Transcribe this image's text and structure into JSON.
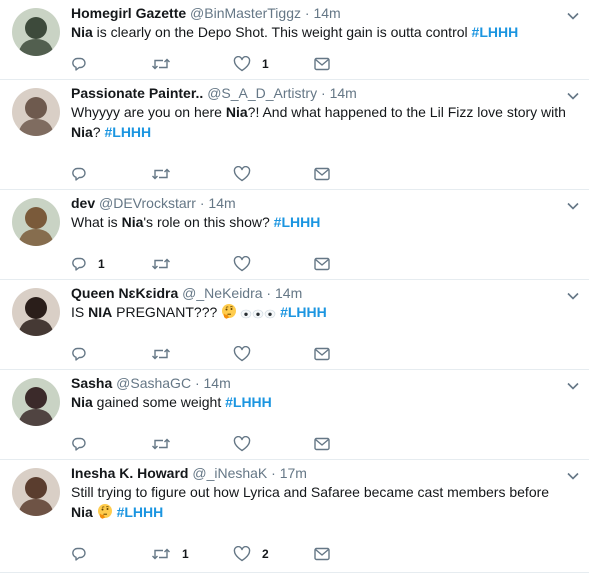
{
  "tweets": [
    {
      "name": "Homegirl Gazette",
      "handle": "@BinMasterTiggz",
      "time": "14m",
      "segments": [
        {
          "t": "Nia",
          "s": "bold"
        },
        {
          "t": " is clearly on the Depo Shot. This weight gain is outta control ",
          "s": "plain"
        },
        {
          "t": "#LHHH",
          "s": "tag"
        }
      ],
      "reply_count": "",
      "retweet_count": "",
      "like_count": "1",
      "avatar_color": "#3d4a3b"
    },
    {
      "name": "Passionate Painter..",
      "handle": "@S_A_D_Artistry",
      "time": "14m",
      "segments": [
        {
          "t": "Whyyyy are you on here ",
          "s": "plain"
        },
        {
          "t": "Nia",
          "s": "bold"
        },
        {
          "t": "?! And what happened to the Lil Fizz love story with ",
          "s": "plain"
        },
        {
          "t": "Nia",
          "s": "bold"
        },
        {
          "t": "? ",
          "s": "plain"
        },
        {
          "t": "#LHHH",
          "s": "tag"
        }
      ],
      "reply_count": "",
      "retweet_count": "",
      "like_count": "",
      "avatar_color": "#6e5a4e"
    },
    {
      "name": "dev",
      "handle": "@DEVrockstarr",
      "time": "14m",
      "segments": [
        {
          "t": "What is ",
          "s": "plain"
        },
        {
          "t": "Nia",
          "s": "bold"
        },
        {
          "t": "'s role on this show? ",
          "s": "plain"
        },
        {
          "t": "#LHHH",
          "s": "tag"
        }
      ],
      "reply_count": "1",
      "retweet_count": "",
      "like_count": "",
      "avatar_color": "#7a5a3a"
    },
    {
      "name": "Queen NɛKɛidra",
      "handle": "@_NeKeidra",
      "time": "14m",
      "segments": [
        {
          "t": "IS ",
          "s": "plain"
        },
        {
          "t": "NIA",
          "s": "bold"
        },
        {
          "t": " PREGNANT??? ",
          "s": "plain"
        },
        {
          "t": "thinking-face",
          "s": "emoji"
        },
        {
          "t": "eyes-row",
          "s": "eyes"
        },
        {
          "t": " ",
          "s": "plain"
        },
        {
          "t": "#LHHH",
          "s": "tag"
        }
      ],
      "reply_count": "",
      "retweet_count": "",
      "like_count": "",
      "avatar_color": "#2a1e1a"
    },
    {
      "name": "Sasha",
      "handle": "@SashaGC",
      "time": "14m",
      "segments": [
        {
          "t": "Nia",
          "s": "bold"
        },
        {
          "t": " gained some weight ",
          "s": "plain"
        },
        {
          "t": "#LHHH",
          "s": "tag"
        }
      ],
      "reply_count": "",
      "retweet_count": "",
      "like_count": "",
      "avatar_color": "#3b2a2a"
    },
    {
      "name": "Inesha K. Howard",
      "handle": "@_iNeshaK",
      "time": "17m",
      "segments": [
        {
          "t": "Still trying to figure out how Lyrica and Safaree became cast members before ",
          "s": "plain"
        },
        {
          "t": "Nia",
          "s": "bold"
        },
        {
          "t": " ",
          "s": "plain"
        },
        {
          "t": "thinking-face",
          "s": "emoji"
        },
        {
          "t": " ",
          "s": "plain"
        },
        {
          "t": "#LHHH",
          "s": "tag"
        }
      ],
      "reply_count": "",
      "retweet_count": "1",
      "like_count": "2",
      "avatar_color": "#5a3d2e"
    }
  ],
  "colors": {
    "hashtag": "#1b95e0",
    "muted": "#657786",
    "divider": "#e6ecf0",
    "text": "#14171a"
  },
  "icons": [
    "reply-icon",
    "retweet-icon",
    "like-icon",
    "dm-icon",
    "chevron-down-icon",
    "thinking-face-emoji",
    "eyes-emoji"
  ]
}
